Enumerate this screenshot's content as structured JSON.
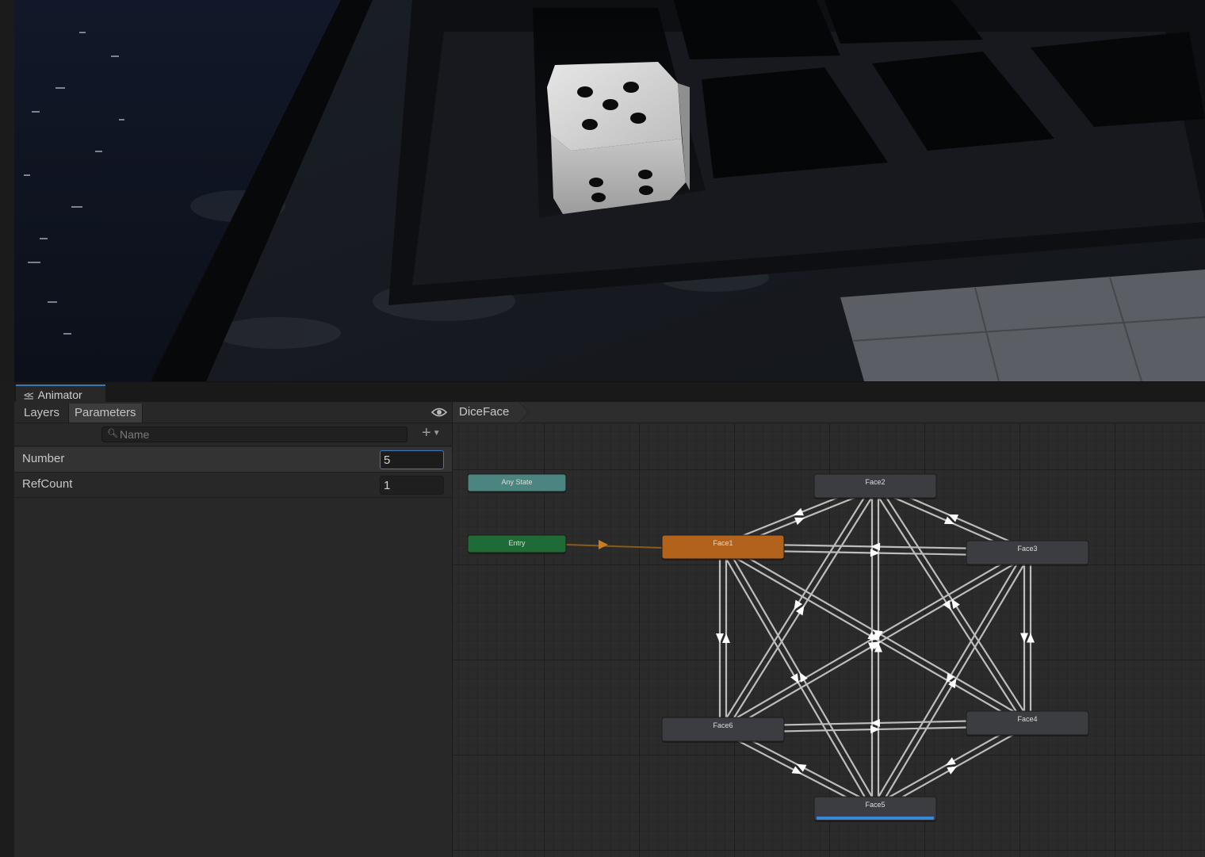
{
  "window": {
    "tab_title": "Animator",
    "tab_icon": "animator-icon"
  },
  "parameters_panel": {
    "tabs": [
      "Layers",
      "Parameters"
    ],
    "active_tab": "Parameters",
    "search_placeholder": "Name",
    "parameters": [
      {
        "name": "Number",
        "value": "5",
        "selected": true
      },
      {
        "name": "RefCount",
        "value": "1",
        "selected": false
      }
    ]
  },
  "graph": {
    "breadcrumb": "DiceFace",
    "states": {
      "any_state": "Any State",
      "entry": "Entry",
      "face1": "Face1",
      "face2": "Face2",
      "face3": "Face3",
      "face4": "Face4",
      "face5": "Face5",
      "face6": "Face6"
    },
    "default_state": "Face1",
    "active_state": "Face5",
    "colors": {
      "any_state": "#4b857f",
      "entry": "#1f6b36",
      "default_state": "#b2621b",
      "state": "#3c3d40",
      "progress": "#3a86d6",
      "selection": "#3a79bb"
    }
  }
}
